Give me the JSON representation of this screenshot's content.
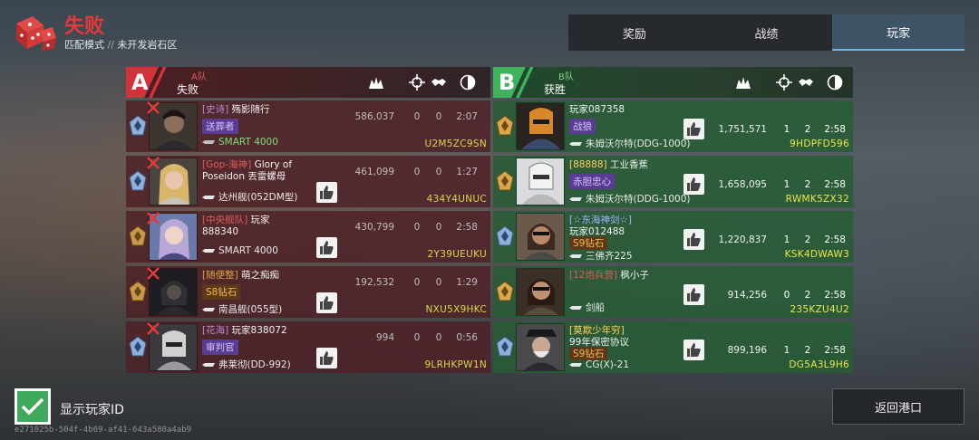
{
  "header": {
    "result_title": "失败",
    "mode": "匹配模式",
    "separator": "//",
    "map": "未开发岩石区"
  },
  "tabs": [
    {
      "label": "奖励",
      "active": false
    },
    {
      "label": "战绩",
      "active": false
    },
    {
      "label": "玩家",
      "active": true
    }
  ],
  "team_a": {
    "letter": "A",
    "name": "A队",
    "result": "失败",
    "players": [
      {
        "clan": "[史诗]",
        "name": "殇影随行",
        "badge": "送葬者",
        "ship": "SMART 4000",
        "score": "586,037",
        "kills": "0",
        "assists": "0",
        "time": "2:07",
        "id": "U2M5ZC9SN"
      },
      {
        "clan": "[Gop-海神]",
        "name": "Glory of Poseidon 丟雷螺母",
        "badge": "",
        "ship": "达州舰(052DM型)",
        "score": "461,099",
        "kills": "0",
        "assists": "0",
        "time": "1:27",
        "id": "434Y4UNUC"
      },
      {
        "clan": "[中央舰队]",
        "name": "玩家888340",
        "badge": "",
        "ship": "SMART 4000",
        "score": "430,799",
        "kills": "0",
        "assists": "0",
        "time": "2:58",
        "id": "2Y39UEUKU"
      },
      {
        "clan": "[随便整]",
        "name": "萌之痴痴",
        "badge": "S8钻石",
        "ship": "南昌舰(055型)",
        "score": "192,532",
        "kills": "0",
        "assists": "0",
        "time": "1:29",
        "id": "NXU5X9HKC"
      },
      {
        "clan": "[花海]",
        "name": "玩家838072",
        "badge": "审判官",
        "ship": "弗莱彻(DD-992)",
        "score": "994",
        "kills": "0",
        "assists": "0",
        "time": "0:56",
        "id": "9LRHKPW1N"
      }
    ]
  },
  "team_b": {
    "letter": "B",
    "name": "B队",
    "result": "获胜",
    "players": [
      {
        "clan": "",
        "name": "玩家087358",
        "badge": "战狼",
        "ship": "朱姆沃尔特(DDG-1000)",
        "score": "1,751,571",
        "kills": "1",
        "assists": "2",
        "time": "2:58",
        "id": "9HDPFD596"
      },
      {
        "clan": "[88888]",
        "name": "工业香蕉",
        "badge": "赤胆忠心",
        "ship": "朱姆沃尔特(DDG-1000)",
        "score": "1,658,095",
        "kills": "1",
        "assists": "2",
        "time": "2:58",
        "id": "RWMK5ZX32"
      },
      {
        "clan": "[☆东海神剑☆]",
        "name": "玩家012488",
        "badge": "S9钻石",
        "ship": "三佛齐225",
        "score": "1,220,837",
        "kills": "1",
        "assists": "2",
        "time": "2:58",
        "id": "KSK4DWAW3"
      },
      {
        "clan": "[12炮兵营]",
        "name": "枫小子",
        "badge": "",
        "ship": "剑船",
        "score": "914,256",
        "kills": "0",
        "assists": "2",
        "time": "2:58",
        "id": "235KZU4U2"
      },
      {
        "clan": "[莫欺少年穷]",
        "name": "99年保密协议",
        "badge": "S9钻石",
        "ship": "CG(X)-21",
        "score": "899,196",
        "kills": "1",
        "assists": "2",
        "time": "2:58",
        "id": "DG5A3L9H6"
      }
    ]
  },
  "bottom": {
    "show_id_label": "显示玩家ID",
    "show_id_checked": true,
    "uuid": "e271025b-504f-4b69-af41-643a580a4ab9",
    "return_label": "返回港口"
  },
  "colors": {
    "defeat": "#e53a3a",
    "team_a": "#d4313a",
    "team_b": "#3fb25c",
    "active_tab": "#3d5366",
    "player_id": "#d8d84c"
  }
}
